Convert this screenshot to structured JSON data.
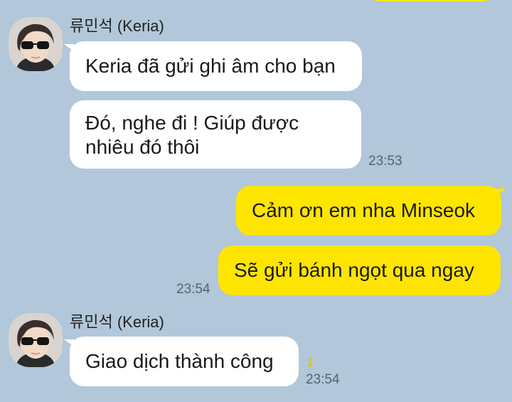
{
  "theme": {
    "background": "#b2c7da",
    "outgoing_bubble": "#fee500",
    "incoming_bubble": "#ffffff",
    "unread_color": "#e0c300"
  },
  "messages": {
    "group1": {
      "sender": "류민석 (Keria)",
      "avatar": "profile-photo-icon",
      "msg1": "Keria đã gửi ghi âm cho bạn",
      "msg2": "Đó, nghe đi ! Giúp được nhiêu đó thôi",
      "time": "23:53"
    },
    "group2": {
      "msg1": "Cảm ơn em nha Minseok",
      "msg2": "Sẽ gửi bánh ngọt qua ngay",
      "time": "23:54"
    },
    "group3": {
      "sender": "류민석 (Keria)",
      "avatar": "profile-photo-icon",
      "msg1": "Giao dịch thành công",
      "unread": "1",
      "time": "23:54"
    }
  }
}
